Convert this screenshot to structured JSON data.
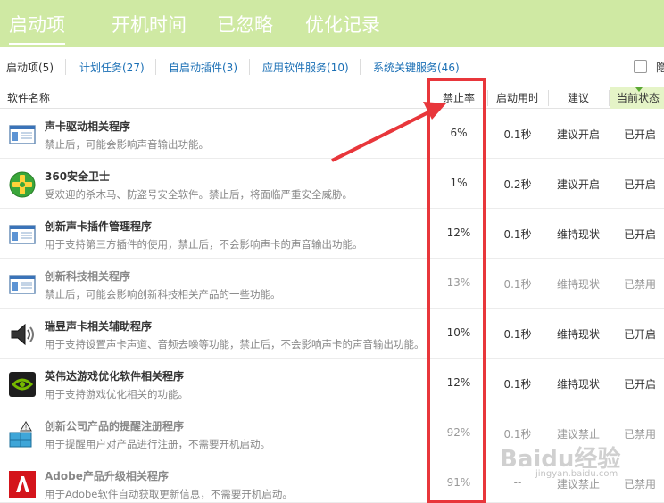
{
  "top_tabs": [
    {
      "label": "启动项",
      "active": true
    },
    {
      "label": "开机时间",
      "active": false
    },
    {
      "label": "已忽略",
      "active": false
    },
    {
      "label": "优化记录",
      "active": false
    }
  ],
  "sub_tabs": [
    {
      "label": "启动项(5)"
    },
    {
      "label": "计划任务(27)"
    },
    {
      "label": "自启动插件(3)"
    },
    {
      "label": "应用软件服务(10)"
    },
    {
      "label": "系统关键服务(46)"
    }
  ],
  "hide_checkbox_label": "隐",
  "columns": {
    "name": "软件名称",
    "rate": "禁止率",
    "time": "启动用时",
    "suggestion": "建议",
    "state": "当前状态"
  },
  "rows": [
    {
      "icon": "sound-driver-icon",
      "title": "声卡驱动相关程序",
      "desc": "禁止后，可能会影响声音输出功能。",
      "rate": "6%",
      "time": "0.1秒",
      "suggestion": "建议开启",
      "state": "已开启",
      "dim": false
    },
    {
      "icon": "360-security-icon",
      "title": "360安全卫士",
      "desc": "受欢迎的杀木马、防盗号安全软件。禁止后，将面临严重安全威胁。",
      "rate": "1%",
      "time": "0.2秒",
      "suggestion": "建议开启",
      "state": "已开启",
      "dim": false
    },
    {
      "icon": "creative-plugin-icon",
      "title": "创新声卡插件管理程序",
      "desc": "用于支持第三方插件的使用，禁止后，不会影响声卡的声音输出功能。",
      "rate": "12%",
      "time": "0.1秒",
      "suggestion": "维持现状",
      "state": "已开启",
      "dim": false
    },
    {
      "icon": "creative-tech-icon",
      "title": "创新科技相关程序",
      "desc": "禁止后，可能会影响创新科技相关产品的一些功能。",
      "rate": "13%",
      "time": "0.1秒",
      "suggestion": "维持现状",
      "state": "已禁用",
      "dim": true
    },
    {
      "icon": "speaker-icon",
      "title": "瑞昱声卡相关辅助程序",
      "desc": "用于支持设置声卡声道、音频去噪等功能，禁止后，不会影响声卡的声音输出功能。",
      "rate": "10%",
      "time": "0.1秒",
      "suggestion": "维持现状",
      "state": "已开启",
      "dim": false
    },
    {
      "icon": "nvidia-icon",
      "title": "英伟达游戏优化软件相关程序",
      "desc": "用于支持游戏优化相关的功能。",
      "rate": "12%",
      "time": "0.1秒",
      "suggestion": "维持现状",
      "state": "已开启",
      "dim": false
    },
    {
      "icon": "creative-register-icon",
      "title": "创新公司产品的提醒注册程序",
      "desc": "用于提醒用户对产品进行注册，不需要开机启动。",
      "rate": "92%",
      "time": "0.1秒",
      "suggestion": "建议禁止",
      "state": "已禁用",
      "dim": true
    },
    {
      "icon": "adobe-icon",
      "title": "Adobe产品升级相关程序",
      "desc": "用于Adobe软件自动获取更新信息，不需要开机启动。",
      "rate": "91%",
      "time": "--",
      "suggestion": "建议禁止",
      "state": "已禁用",
      "dim": true
    }
  ],
  "watermark": "Baidu经验",
  "watermark_sub": "jingyan.baidu.com",
  "colors": {
    "accent_bar": "#cfe9a3",
    "link": "#1a6fb5",
    "annotation": "#e8363b"
  }
}
